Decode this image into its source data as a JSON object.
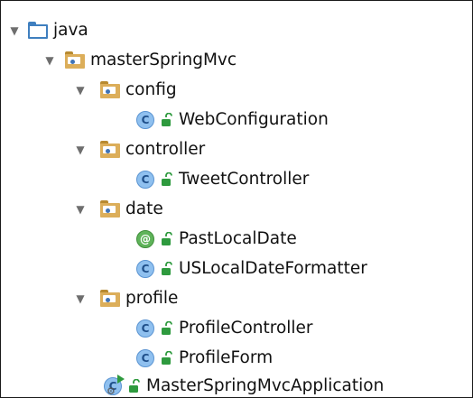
{
  "tree": {
    "root": "java",
    "module": "masterSpringMvc",
    "packages": [
      {
        "name": "config",
        "items": [
          {
            "name": "WebConfiguration",
            "kind": "class"
          }
        ]
      },
      {
        "name": "controller",
        "items": [
          {
            "name": "TweetController",
            "kind": "class"
          }
        ]
      },
      {
        "name": "date",
        "items": [
          {
            "name": "PastLocalDate",
            "kind": "annotation"
          },
          {
            "name": "USLocalDateFormatter",
            "kind": "class"
          }
        ]
      },
      {
        "name": "profile",
        "items": [
          {
            "name": "ProfileController",
            "kind": "class"
          },
          {
            "name": "ProfileForm",
            "kind": "class"
          }
        ]
      }
    ],
    "app_class": "MasterSpringMvcApplication",
    "class_glyph": "C",
    "annotation_glyph": "@",
    "expanded_glyph": "▼"
  },
  "colors": {
    "source_folder": "#3f7fbf",
    "package_folder": "#dcae5a",
    "class_icon": "#8fc0ef",
    "annotation_icon": "#5fb35a",
    "lock": "#2e9a3e"
  }
}
